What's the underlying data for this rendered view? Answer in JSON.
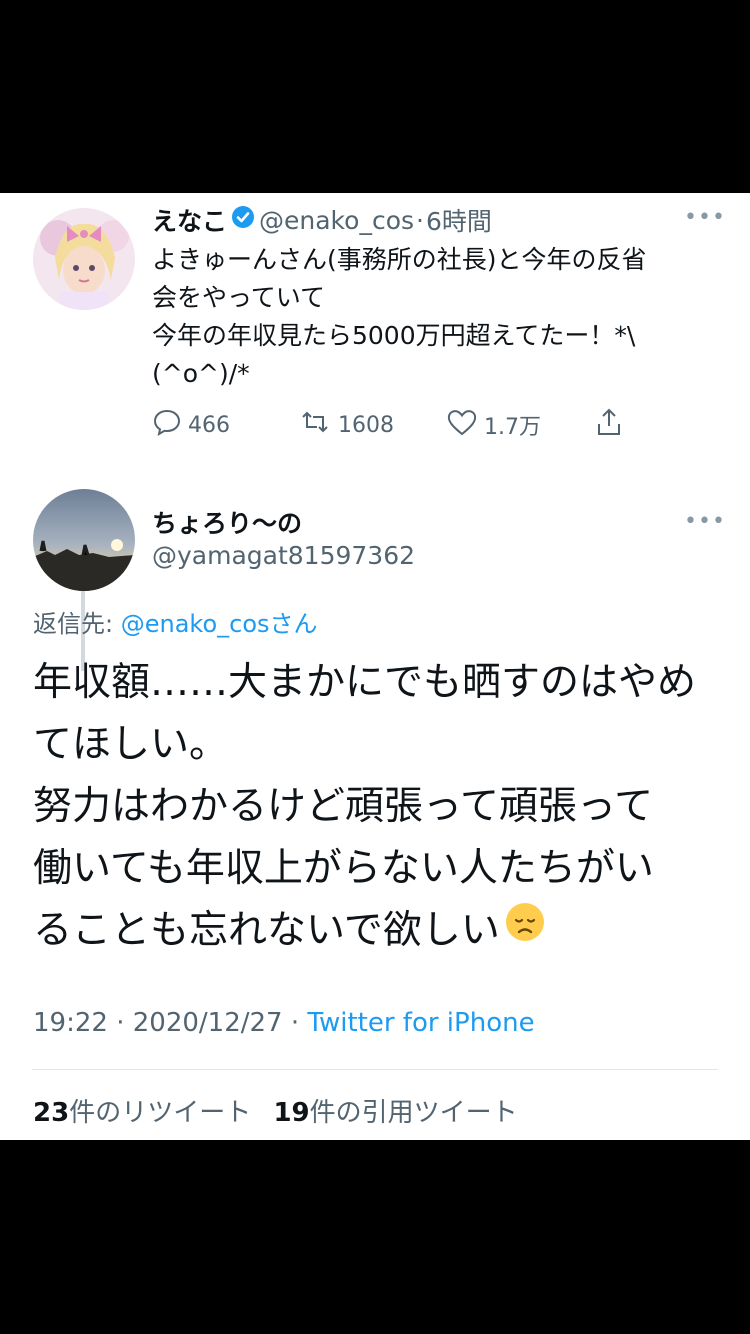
{
  "parent_tweet": {
    "display_name": "えなこ",
    "handle": "@enako_cos",
    "separator": "·",
    "time_ago": "6時間",
    "text_lines": [
      "よきゅーんさん(事務所の社長)と今年の反省",
      "会をやっていて",
      "今年の年収見たら5000万円超えてたー！*\\",
      "(^o^)/*"
    ],
    "reply_count": "466",
    "retweet_count": "1608",
    "like_count": "1.7万"
  },
  "reply_tweet": {
    "display_name": "ちょろり〜の",
    "handle": "@yamagat81597362",
    "reply_to_prefix": "返信先: ",
    "reply_to_handle": "@enako_cos",
    "reply_to_suffix": "さん",
    "text_lines": [
      "年収額……大まかにでも晒すのはやめ",
      "てほしい。",
      "努力はわかるけど頑張って頑張って",
      "働いても年収上がらない人たちがい",
      "ることも忘れないで欲しい"
    ],
    "emoji": "disappointed-face",
    "time": "19:22",
    "date_sep": " · ",
    "date": "2020/12/27",
    "client": "Twitter for iPhone",
    "retweets_count": "23",
    "retweets_label": "件のリツイート",
    "quotes_count": "19",
    "quotes_label": "件の引用ツイート"
  },
  "colors": {
    "accent": "#1d9bf0",
    "text": "#0f1419",
    "muted": "#536471",
    "background": "#ffffff",
    "letterbox": "#000000"
  }
}
